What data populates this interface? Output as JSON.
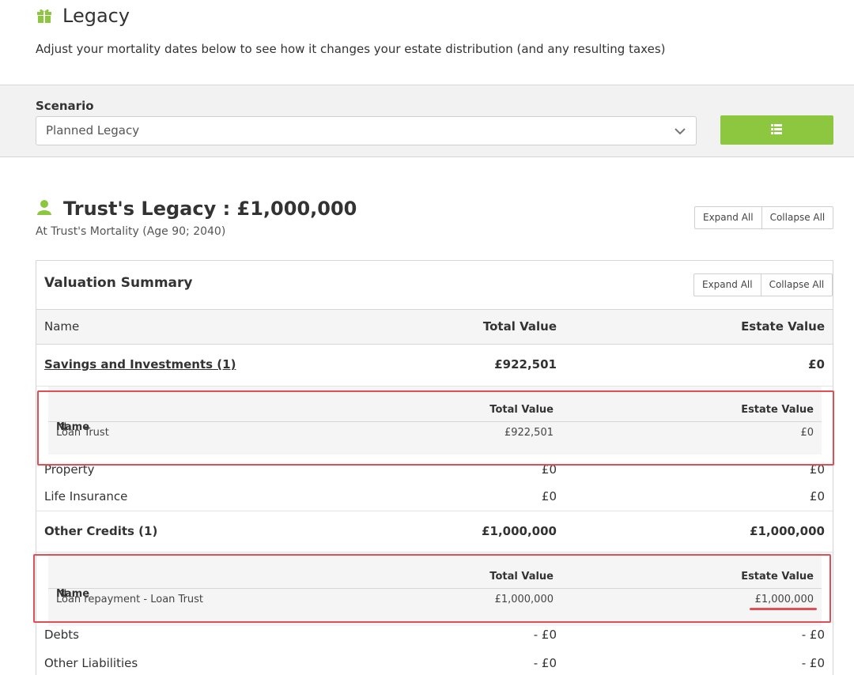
{
  "header": {
    "title": "Legacy",
    "subtitle": "Adjust your mortality dates below to see how it changes your estate distribution (and any resulting taxes)"
  },
  "scenario": {
    "label": "Scenario",
    "selected": "Planned Legacy"
  },
  "legacy": {
    "title": "Trust's Legacy : £1,000,000",
    "subtitle": "At Trust's Mortality (Age 90; 2040)",
    "expand_all": "Expand All",
    "collapse_all": "Collapse All"
  },
  "valuation": {
    "title": "Valuation Summary",
    "expand_all": "Expand All",
    "collapse_all": "Collapse All",
    "columns": {
      "name": "Name",
      "total": "Total Value",
      "estate": "Estate Value"
    },
    "savings": {
      "name": "Savings and Investments (1)",
      "total": "£922,501",
      "estate": "£0"
    },
    "savings_detail": {
      "columns": {
        "name": "Name",
        "total": "Total Value",
        "estate": "Estate Value"
      },
      "row": {
        "name": "Loan Trust",
        "total": "£922,501",
        "estate": "£0"
      }
    },
    "property": {
      "name": "Property",
      "total": "£0",
      "estate": "£0"
    },
    "life_insurance": {
      "name": "Life Insurance",
      "total": "£0",
      "estate": "£0"
    },
    "other_credits": {
      "name": "Other Credits (1)",
      "total": "£1,000,000",
      "estate": "£1,000,000"
    },
    "other_credits_detail": {
      "columns": {
        "name": "Name",
        "total": "Total Value",
        "estate": "Estate Value"
      },
      "row": {
        "name": "Loan repayment - Loan Trust",
        "total": "£1,000,000",
        "estate": "£1,000,000"
      }
    },
    "debts": {
      "name": "Debts",
      "total": "- £0",
      "estate": "- £0"
    },
    "other_liabilities": {
      "name": "Other Liabilities",
      "total": "- £0",
      "estate": "- £0"
    }
  },
  "colors": {
    "accent_green": "#8dc63f",
    "highlight_red": "#e34d54"
  }
}
